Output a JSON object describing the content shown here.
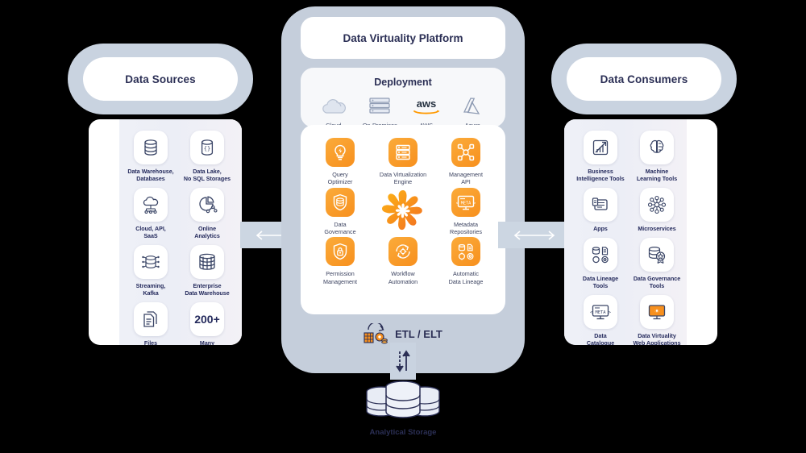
{
  "sources": {
    "header": "Data Sources",
    "tiles": [
      {
        "icon": "database-icon",
        "label": "Data Warehouse,\nDatabases"
      },
      {
        "icon": "data-lake-icon",
        "label": "Data Lake,\nNo SQL Storages"
      },
      {
        "icon": "cloud-api-icon",
        "label": "Cloud, API,\nSaaS"
      },
      {
        "icon": "online-analytics-icon",
        "label": "Online\nAnalytics"
      },
      {
        "icon": "streaming-kafka-icon",
        "label": "Streaming,\nKafka"
      },
      {
        "icon": "enterprise-dw-icon",
        "label": "Enterprise\nData Warehouse"
      },
      {
        "icon": "files-icon",
        "label": "Files\n(CSV, JSON, XML)"
      },
      {
        "icon": "count-badge",
        "badge": "200+",
        "label": "Many\nmore..."
      }
    ]
  },
  "platform": {
    "title": "Data Virtuality Platform",
    "deployment": {
      "title": "Deployment",
      "items": [
        {
          "icon": "cloud-icon",
          "label": "Cloud"
        },
        {
          "icon": "server-rack-icon",
          "label": "On-Premises"
        },
        {
          "icon": "aws-logo-icon",
          "label": "AWS"
        },
        {
          "icon": "azure-logo-icon",
          "label": "Azure"
        }
      ]
    },
    "features": [
      {
        "icon": "lightbulb-icon",
        "label": "Query\nOptimizer"
      },
      {
        "icon": "server-stack-icon",
        "label": "Data Virtualization\nEngine"
      },
      {
        "icon": "network-node-icon",
        "label": "Management\nAPI"
      },
      {
        "icon": "shield-database-icon",
        "label": "Data\nGovernance"
      },
      {
        "icon": "data-virtuality-logo",
        "label": ""
      },
      {
        "icon": "meta-screen-icon",
        "label": "Metadata\nRepositories"
      },
      {
        "icon": "shield-lock-icon",
        "label": "Permission\nManagement"
      },
      {
        "icon": "gear-cycle-icon",
        "label": "Workflow\nAutomation"
      },
      {
        "icon": "lineage-icon",
        "label": "Automatic\nData Lineage"
      }
    ],
    "etl": {
      "icon": "etl-icon",
      "label": "ETL / ELT"
    }
  },
  "consumers": {
    "header": "Data Consumers",
    "tiles": [
      {
        "icon": "bi-chart-icon",
        "label": "Business\nIntelligence Tools"
      },
      {
        "icon": "brain-ml-icon",
        "label": "Machine\nLearning Tools"
      },
      {
        "icon": "apps-icon",
        "label": "Apps"
      },
      {
        "icon": "microservices-icon",
        "label": "Microservices"
      },
      {
        "icon": "data-lineage-tools-icon",
        "label": "Data Lineage\nTools"
      },
      {
        "icon": "governance-badge-icon",
        "label": "Data Governance\nTools"
      },
      {
        "icon": "catalogue-screen-icon",
        "label": "Data\nCatalogue"
      },
      {
        "icon": "web-app-icon",
        "label": "Data Virtuality\nWeb Applications"
      }
    ]
  },
  "storage": {
    "icon": "database-stack-icon",
    "label": "Analytical Storage"
  },
  "connectors": {
    "left_arrow": "bidirectional-arrow",
    "right_arrow": "bidirectional-arrow",
    "bottom_arrow": "updown-arrow"
  },
  "colors": {
    "background": "#000000",
    "panel": "#ffffff",
    "capsule": "#c9d3e0",
    "platform": "#c5cedb",
    "accent_orange": "#f7901e",
    "accent_orange_light": "#fbab3a",
    "text_dark": "#2b2f55",
    "text_muted": "#4a5570"
  }
}
